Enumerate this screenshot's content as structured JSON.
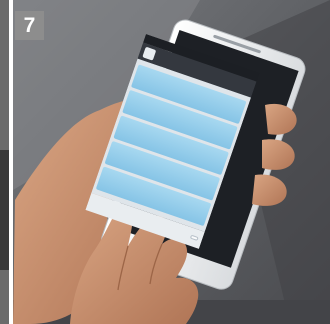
{
  "badge": {
    "number": "7",
    "color": "#8d8d8d"
  },
  "phone": {
    "status_time": "",
    "app_title": "",
    "app_subtitle": "",
    "messages": [],
    "reply_label": ""
  },
  "colors": {
    "background": "#5f6166",
    "phone_body": "#f4f5f6",
    "message_bubble": "#9fd3ee",
    "skin": "#c9926f"
  }
}
